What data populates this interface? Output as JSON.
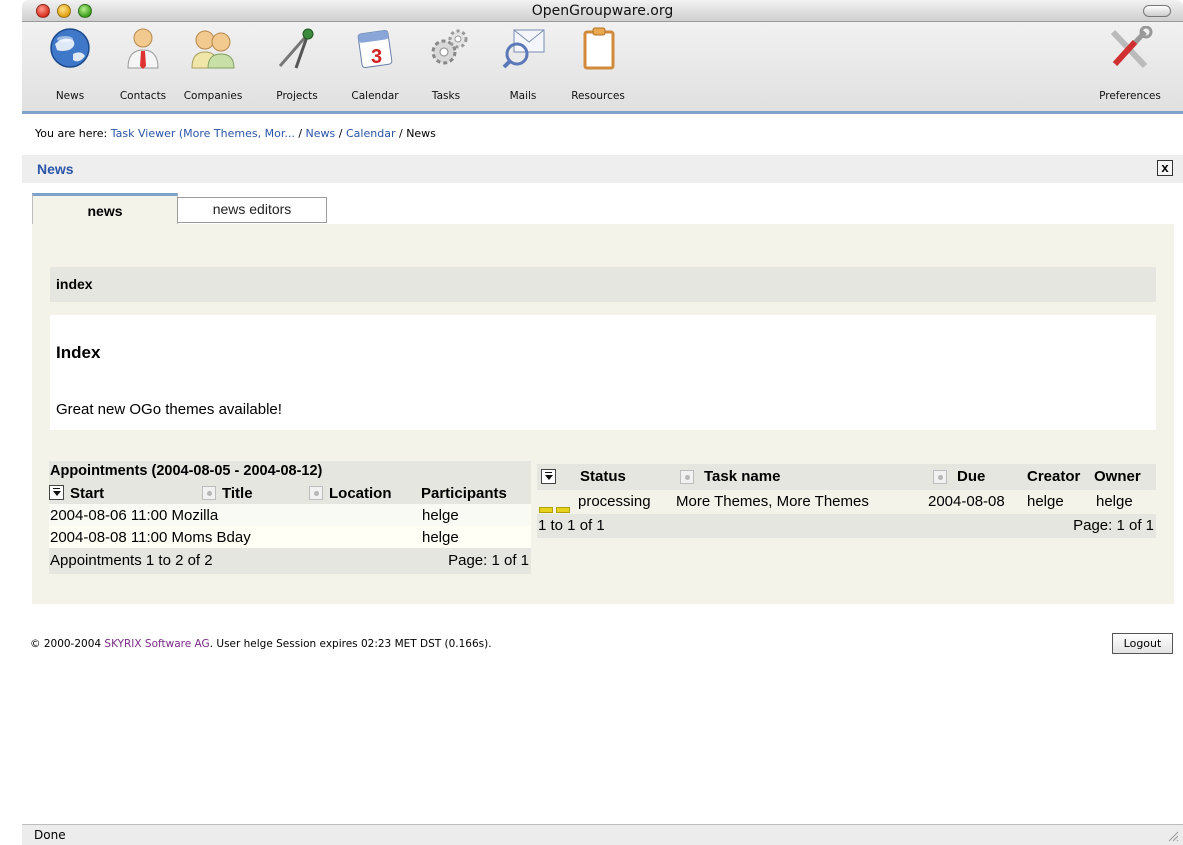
{
  "window": {
    "title": "OpenGroupware.org"
  },
  "toolbar": {
    "items": [
      {
        "label": "News",
        "icon": "globe-news-icon"
      },
      {
        "label": "Contacts",
        "icon": "person-contacts-icon"
      },
      {
        "label": "Companies",
        "icon": "people-companies-icon"
      },
      {
        "label": "Projects",
        "icon": "compass-projects-icon"
      },
      {
        "label": "Calendar",
        "icon": "calendar-icon"
      },
      {
        "label": "Tasks",
        "icon": "gears-tasks-icon"
      },
      {
        "label": "Mails",
        "icon": "envelope-mails-icon"
      },
      {
        "label": "Resources",
        "icon": "clipboard-resources-icon"
      }
    ],
    "preferences": {
      "label": "Preferences",
      "icon": "tools-preferences-icon"
    }
  },
  "breadcrumb": {
    "prefix": "You are here:",
    "crumbs": [
      "Task Viewer (More Themes, Mor...",
      "News",
      "Calendar"
    ],
    "separator": "/",
    "current": "News"
  },
  "section": {
    "title": "News",
    "close_label": "x"
  },
  "tabs": [
    {
      "label": "news",
      "active": true
    },
    {
      "label": "news editors",
      "active": false
    }
  ],
  "index": {
    "bar_label": "index",
    "heading": "Index",
    "text": "Great new OGo themes available!"
  },
  "appointments": {
    "caption": "Appointments (2004-08-05 - 2004-08-12)",
    "columns": [
      "Start",
      "Title",
      "Location",
      "Participants"
    ],
    "rows": [
      {
        "start": "2004-08-06 11:00",
        "title": "Mozilla",
        "location": "",
        "participants": "helge"
      },
      {
        "start": "2004-08-08 11:00",
        "title": "Moms Bday",
        "location": "",
        "participants": "helge"
      }
    ],
    "footer_left": "Appointments 1 to 2 of 2",
    "footer_right": "Page: 1 of 1"
  },
  "tasks": {
    "columns": [
      "Status",
      "Task name",
      "Due",
      "Creator",
      "Owner"
    ],
    "rows": [
      {
        "status": "processing",
        "name": "More Themes, More Themes",
        "due": "2004-08-08",
        "creator": "helge",
        "owner": "helge"
      }
    ],
    "footer_left": "1 to 1 of 1",
    "footer_right": "Page: 1 of 1"
  },
  "footer": {
    "copyright": "© 2000-2004",
    "company": "SKYRIX Software AG",
    "session_text": ". User helge Session expires 02:23 MET DST (0.166s).",
    "logout_label": "Logout"
  },
  "statusbar": {
    "text": "Done"
  },
  "colors": {
    "accent": "#7fa2c8",
    "link": "#2a55a8",
    "panel": "#f3f3ea",
    "company_link": "#7a2a86"
  }
}
